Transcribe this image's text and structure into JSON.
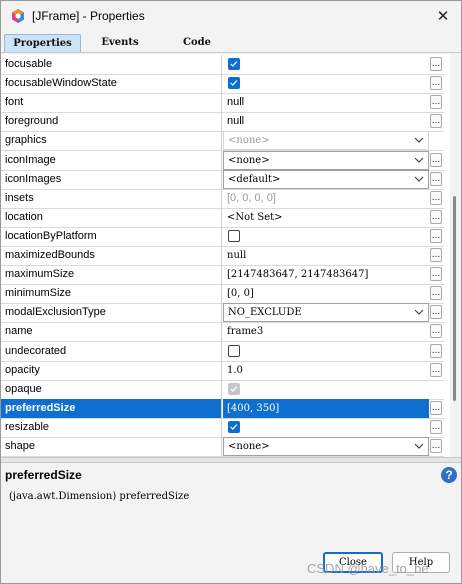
{
  "window": {
    "title": "[JFrame] - Properties",
    "close_glyph": "✕"
  },
  "tabs": [
    {
      "label": "Properties",
      "active": true
    },
    {
      "label": "Events",
      "active": false
    },
    {
      "label": "Code",
      "active": false
    }
  ],
  "properties": [
    {
      "name": "focusable",
      "type": "checkbox",
      "checked": true,
      "enabled": true,
      "custom_button": "..."
    },
    {
      "name": "focusableWindowState",
      "type": "checkbox",
      "checked": true,
      "enabled": true,
      "custom_button": "..."
    },
    {
      "name": "font",
      "type": "text",
      "value": "null",
      "style": "sans",
      "custom_button": "..."
    },
    {
      "name": "foreground",
      "type": "text",
      "value": "null",
      "style": "sans",
      "custom_button": "..."
    },
    {
      "name": "graphics",
      "type": "combo",
      "value": "<none>",
      "enabled": false
    },
    {
      "name": "iconImage",
      "type": "combo",
      "value": "<none>",
      "enabled": true,
      "custom_button": "..."
    },
    {
      "name": "iconImages",
      "type": "combo",
      "value": "<default>",
      "enabled": true,
      "custom_button": "..."
    },
    {
      "name": "insets",
      "type": "text",
      "value": "[0, 0, 0, 0]",
      "style": "muted-sans",
      "custom_button": "..."
    },
    {
      "name": "location",
      "type": "text",
      "value": "<Not Set>",
      "style": "serif",
      "custom_button": "..."
    },
    {
      "name": "locationByPlatform",
      "type": "checkbox",
      "checked": false,
      "enabled": true,
      "custom_button": "..."
    },
    {
      "name": "maximizedBounds",
      "type": "text",
      "value": "null",
      "style": "serif",
      "custom_button": "..."
    },
    {
      "name": "maximumSize",
      "type": "text",
      "value": "[2147483647, 2147483647]",
      "style": "serif",
      "custom_button": "..."
    },
    {
      "name": "minimumSize",
      "type": "text",
      "value": "[0, 0]",
      "style": "serif",
      "custom_button": "..."
    },
    {
      "name": "modalExclusionType",
      "type": "combo",
      "value": "NO_EXCLUDE",
      "enabled": true,
      "custom_button": "..."
    },
    {
      "name": "name",
      "type": "text",
      "value": "frame3",
      "style": "serif",
      "custom_button": "..."
    },
    {
      "name": "undecorated",
      "type": "checkbox",
      "checked": false,
      "enabled": true,
      "custom_button": "..."
    },
    {
      "name": "opacity",
      "type": "text",
      "value": "1.0",
      "style": "serif",
      "custom_button": "..."
    },
    {
      "name": "opaque",
      "type": "checkbox",
      "checked": true,
      "enabled": false
    },
    {
      "name": "preferredSize",
      "type": "text",
      "value": "[400, 350]",
      "style": "serif",
      "selected": true,
      "custom_button": "..."
    },
    {
      "name": "resizable",
      "type": "checkbox",
      "checked": true,
      "enabled": true,
      "custom_button": "..."
    },
    {
      "name": "shape",
      "type": "combo",
      "value": "<none>",
      "enabled": true,
      "custom_button": "..."
    }
  ],
  "description": {
    "title": "preferredSize",
    "text": "(java.awt.Dimension) preferredSize",
    "help_glyph": "?"
  },
  "buttons": {
    "close": "Close",
    "help": "Help"
  },
  "watermark": "CSDN @have_to_be",
  "colors": {
    "selection": "#0f6fd1",
    "checkbox_on": "#0f6fd1",
    "tab_active": "#cfe3f6",
    "help_icon": "#2f6fc4"
  },
  "icons": {
    "app": "netbeans-form-icon",
    "close": "close-icon",
    "dropdown": "chevron-down-icon",
    "help": "help-icon"
  }
}
